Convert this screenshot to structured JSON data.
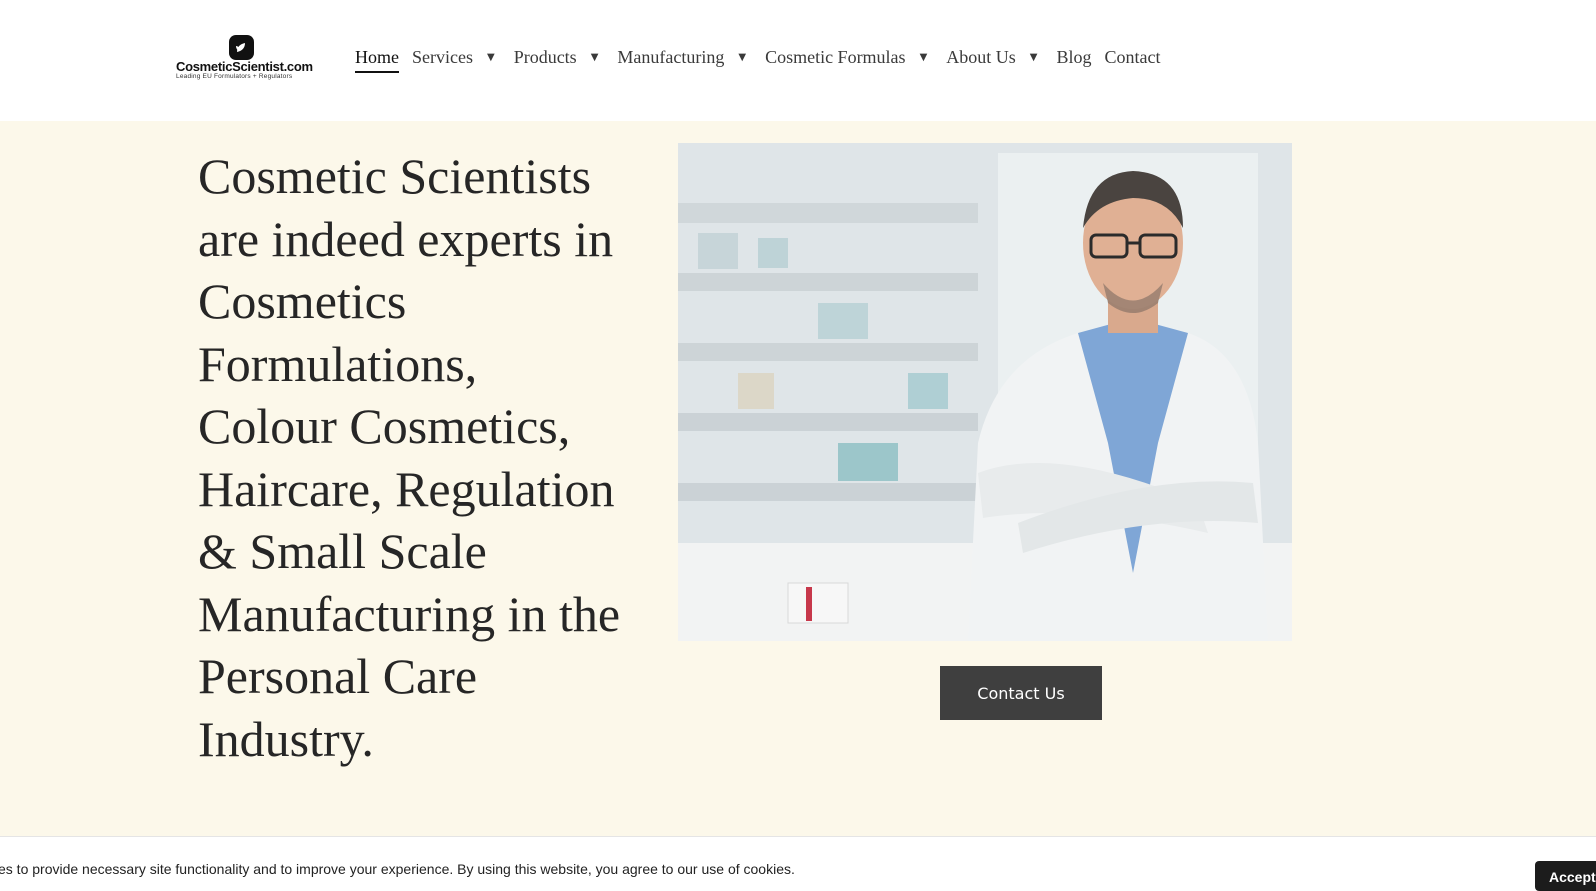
{
  "header": {
    "logo": {
      "name": "CosmeticScientist.com",
      "tagline": "Leading EU Formulators + Regulators",
      "icon": "leaf-logo-icon"
    },
    "nav": [
      {
        "label": "Home",
        "active": true,
        "dropdown": false
      },
      {
        "label": "Services",
        "active": false,
        "dropdown": true
      },
      {
        "label": "Products",
        "active": false,
        "dropdown": true
      },
      {
        "label": "Manufacturing",
        "active": false,
        "dropdown": true
      },
      {
        "label": "Cosmetic Formulas",
        "active": false,
        "dropdown": true
      },
      {
        "label": "About Us",
        "active": false,
        "dropdown": true
      },
      {
        "label": "Blog",
        "active": false,
        "dropdown": false
      },
      {
        "label": "Contact",
        "active": false,
        "dropdown": false
      }
    ],
    "caret_glyph": "▼"
  },
  "hero": {
    "title": "Cosmetic Scientists are indeed experts in Cosmetics Formulations, Colour Cosmetics, Haircare, Regulation & Small Scale Manufacturing in the Personal Care Industry.",
    "cta_label": "Contact Us"
  },
  "cookie_bar": {
    "text": "es to provide necessary site functionality and to improve your experience. By using this website, you agree to our use of cookies.",
    "accept_label": "Accept"
  },
  "colors": {
    "hero_background": "#fcf8ea",
    "button": "#3f3f3f",
    "text": "#262626"
  }
}
